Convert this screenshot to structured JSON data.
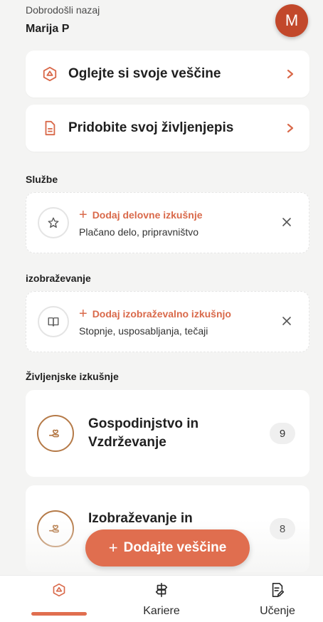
{
  "header": {
    "welcome": "Dobrodošli nazaj",
    "username": "Marija P",
    "avatar_letter": "M"
  },
  "actions": [
    {
      "label": "Oglejte si svoje veščine",
      "icon": "skills-hexagon-icon"
    },
    {
      "label": "Pridobite svoj življenjepis",
      "icon": "document-icon"
    }
  ],
  "sections": {
    "services": {
      "title": "Službe",
      "add_label": "Dodaj delovne izkušnje",
      "subtitle": "Plačano delo, pripravništvo",
      "icon": "star-icon"
    },
    "education": {
      "title": "izobraževanje",
      "add_label": "Dodaj izobraževalno izkušnjo",
      "subtitle": "Stopnje, usposabljanja, tečaji",
      "icon": "book-icon"
    },
    "life": {
      "title": "Življenjske izkušnje",
      "items": [
        {
          "title": "Gospodinjstvo in Vzdrževanje",
          "count": "9",
          "icon": "hand-heart-icon"
        },
        {
          "title": "Izobraževanje in",
          "count": "8",
          "icon": "hand-heart-icon"
        }
      ]
    }
  },
  "fab": {
    "label": "Dodajte veščine"
  },
  "nav": {
    "items": [
      {
        "label": "",
        "icon": "skills-hexagon-icon"
      },
      {
        "label": "Kariere",
        "icon": "signpost-icon"
      },
      {
        "label": "Učenje",
        "icon": "notes-icon"
      }
    ]
  },
  "colors": {
    "accent": "#e06e4f",
    "avatar": "#c2482b",
    "ring": "#b57a48"
  }
}
